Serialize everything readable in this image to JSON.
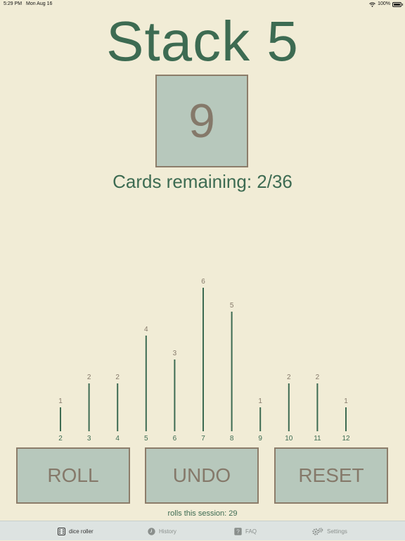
{
  "status": {
    "time": "5:29 PM",
    "date": "Mon Aug 16",
    "battery": "100%"
  },
  "title": "Stack 5",
  "card_value": "9",
  "cards_remaining": "Cards remaining: 2/36",
  "chart_data": {
    "type": "bar",
    "categories": [
      "2",
      "3",
      "4",
      "5",
      "6",
      "7",
      "8",
      "9",
      "10",
      "11",
      "12"
    ],
    "values": [
      1,
      2,
      2,
      4,
      3,
      6,
      5,
      1,
      2,
      2,
      1
    ],
    "ylim": [
      0,
      6
    ],
    "title": "",
    "xlabel": "",
    "ylabel": "",
    "bar_color": "#3d6b52",
    "label_color": "#85796a"
  },
  "buttons": {
    "roll": "ROLL",
    "undo": "UNDO",
    "reset": "RESET"
  },
  "rolls_session": "rolls this session: 29",
  "tabs": [
    {
      "label": "dice roller",
      "icon": "dice-icon",
      "active": true
    },
    {
      "label": "History",
      "icon": "clock-icon",
      "active": false
    },
    {
      "label": "FAQ",
      "icon": "question-icon",
      "active": false
    },
    {
      "label": "Settings",
      "icon": "gears-icon",
      "active": false
    }
  ],
  "colors": {
    "background": "#f1ecd6",
    "accent": "#3d6b52",
    "card": "#b7c8bc",
    "border": "#8c7d6a"
  }
}
